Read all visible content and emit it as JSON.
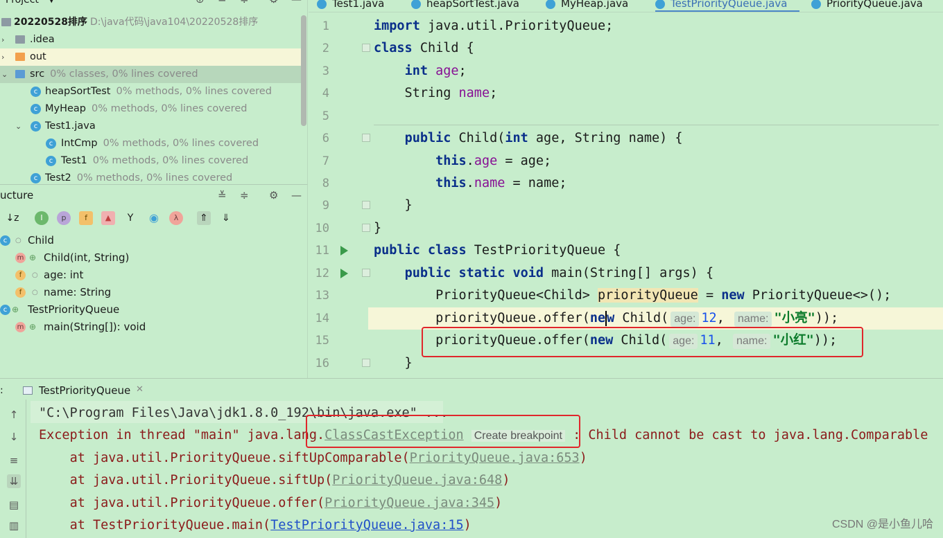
{
  "project": {
    "title": "Project",
    "root": {
      "name": "20220528排序",
      "path": "D:\\java代码\\java104\\20220528排序"
    },
    "items": [
      {
        "name": ".idea",
        "meta": ""
      },
      {
        "name": "out",
        "meta": ""
      },
      {
        "name": "src",
        "meta": "0% classes, 0% lines covered"
      },
      {
        "name": "heapSortTest",
        "meta": "0% methods, 0% lines covered"
      },
      {
        "name": "MyHeap",
        "meta": "0% methods, 0% lines covered"
      },
      {
        "name": "Test1.java",
        "meta": ""
      },
      {
        "name": "IntCmp",
        "meta": "0% methods, 0% lines covered"
      },
      {
        "name": "Test1",
        "meta": "0% methods, 0% lines covered"
      },
      {
        "name": "Test2",
        "meta": "0% methods, 0% lines covered"
      }
    ]
  },
  "structure": {
    "title": "ucture",
    "items": [
      {
        "name": "Child"
      },
      {
        "name": "Child(int, String)"
      },
      {
        "name": "age: int"
      },
      {
        "name": "name: String"
      },
      {
        "name": "TestPriorityQueue"
      },
      {
        "name": "main(String[]): void"
      }
    ]
  },
  "tabs": [
    "Test1.java",
    "heapSortTest.java",
    "MyHeap.java",
    "TestPriorityQueue.java",
    "PriorityQueue.java"
  ],
  "editor": {
    "line_numbers": [
      "1",
      "2",
      "3",
      "4",
      "5",
      "6",
      "7",
      "8",
      "9",
      "10",
      "11",
      "12",
      "13",
      "14",
      "15",
      "16"
    ],
    "hint_age": "age:",
    "hint_name": "name:",
    "val_12": "12",
    "val_11": "11",
    "str_1": "\"小亮\"",
    "str_2": "\"小红\""
  },
  "run": {
    "tab_label": "TestPriorityQueue",
    "cmd": "\"C:\\Program Files\\Java\\jdk1.8.0_192\\bin\\java.exe\" ...",
    "exc_prefix": "Exception in thread \"main\" java.lang.",
    "exc_class": "ClassCastException",
    "create_bp": "Create breakpoint",
    "exc_suffix": ": Child cannot be cast to java.lang.Comparable",
    "stack": [
      {
        "at": "at java.util.PriorityQueue.siftUpComparable(",
        "link": "PriorityQueue.java:653",
        "end": ")"
      },
      {
        "at": "at java.util.PriorityQueue.siftUp(",
        "link": "PriorityQueue.java:648",
        "end": ")"
      },
      {
        "at": "at java.util.PriorityQueue.offer(",
        "link": "PriorityQueue.java:345",
        "end": ")"
      },
      {
        "at": "at TestPriorityQueue.main(",
        "link": "TestPriorityQueue.java:15",
        "end": ")"
      }
    ]
  },
  "watermark": "CSDN @是小鱼儿哈",
  "colors": {
    "background": "#c7edcc",
    "highlight_box": "#e0262b",
    "keyword": "#0a2f8a",
    "field": "#871094",
    "string": "#0a7a2a",
    "number": "#1750eb"
  }
}
